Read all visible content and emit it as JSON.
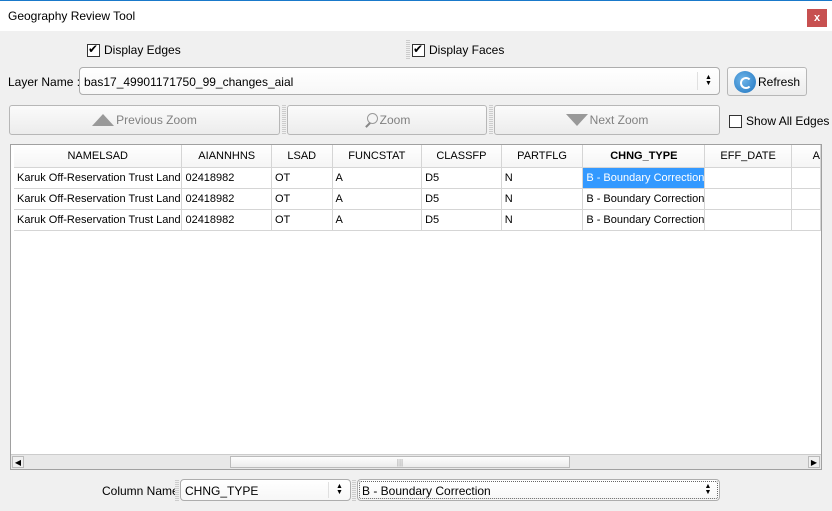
{
  "window": {
    "title": "Geography Review Tool",
    "close_label": "x"
  },
  "options": {
    "display_edges": {
      "label": "Display Edges",
      "checked": true
    },
    "display_faces": {
      "label": "Display Faces",
      "checked": true
    },
    "show_all_edges": {
      "label": "Show All Edges",
      "checked": false
    }
  },
  "layer": {
    "label": "Layer Name :",
    "value": "bas17_49901171750_99_changes_aial",
    "refresh_label": "Refresh"
  },
  "zoom_bar": {
    "previous_label": "Previous Zoom",
    "zoom_label": "Zoom",
    "next_label": "Next Zoom"
  },
  "table": {
    "columns": [
      "NAMELSAD",
      "AIANNHNS",
      "LSAD",
      "FUNCSTAT",
      "CLASSFP",
      "PARTFLG",
      "CHNG_TYPE",
      "EFF_DATE",
      "A"
    ],
    "sorted_column": "CHNG_TYPE",
    "rows": [
      [
        "Karuk Off-Reservation Trust Land",
        "02418982",
        "OT",
        "A",
        "D5",
        "N",
        "B - Boundary Correction",
        "",
        ""
      ],
      [
        "Karuk Off-Reservation Trust Land",
        "02418982",
        "OT",
        "A",
        "D5",
        "N",
        "B - Boundary Correction",
        "",
        ""
      ],
      [
        "Karuk Off-Reservation Trust Land",
        "02418982",
        "OT",
        "A",
        "D5",
        "N",
        "B - Boundary Correction",
        "",
        ""
      ]
    ],
    "selected_cell": {
      "row": 0,
      "column": "CHNG_TYPE"
    }
  },
  "filter": {
    "column_label": "Column Name :",
    "column_value": "CHNG_TYPE",
    "value": "B - Boundary Correction"
  },
  "colors": {
    "selection": "#3399ff",
    "close": "#c75050",
    "title_accent": "#1979ca"
  }
}
